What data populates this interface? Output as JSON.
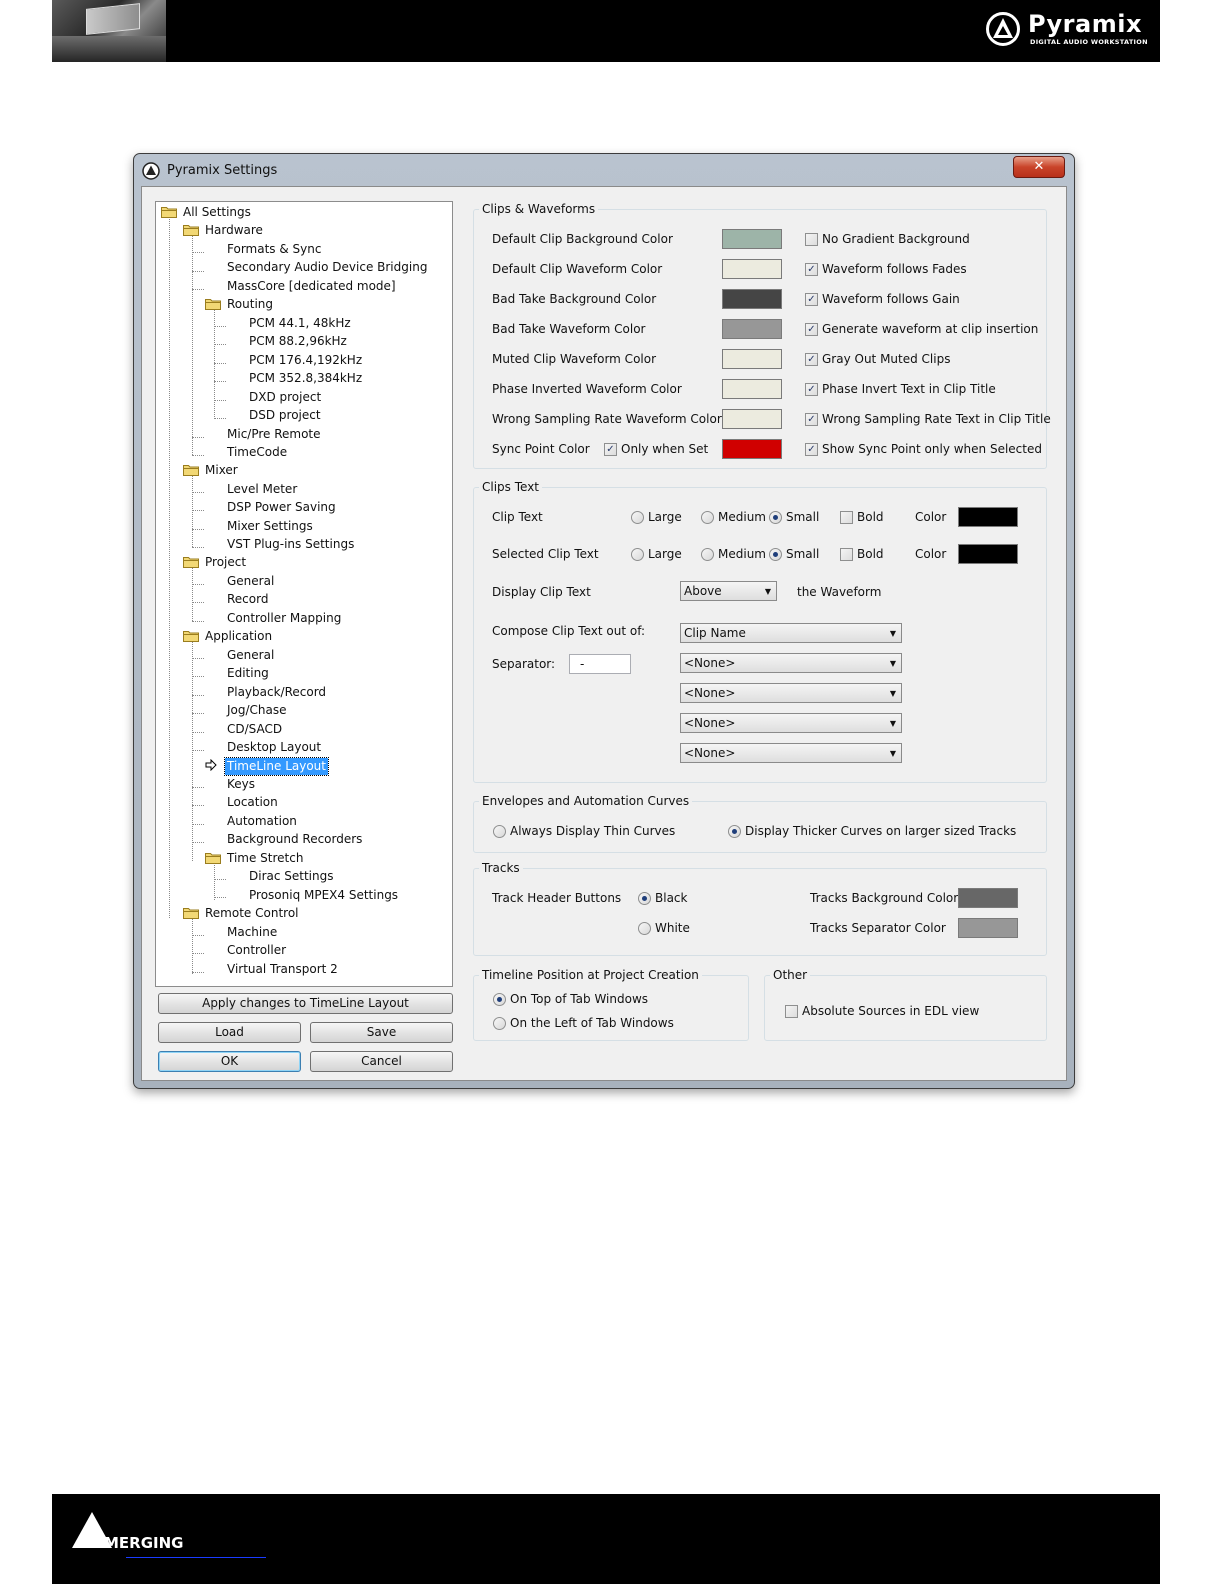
{
  "page_header": {
    "brand": "Pyramix",
    "tagline": "DIGITAL AUDIO WORKSTATION"
  },
  "page_footer": {
    "brand": "MERGING"
  },
  "window": {
    "title": "Pyramix Settings",
    "close_label": "✕"
  },
  "tree": {
    "root": "All Settings",
    "groups": {
      "hardware": "Hardware",
      "routing": "Routing",
      "mixer": "Mixer",
      "project": "Project",
      "application": "Application",
      "time_stretch": "Time Stretch",
      "remote_control": "Remote Control"
    },
    "hardware_items": [
      "Formats & Sync",
      "Secondary Audio Device Bridging",
      "MassCore [dedicated mode]"
    ],
    "routing_items": [
      "PCM 44.1, 48kHz",
      "PCM 88.2,96kHz",
      "PCM 176.4,192kHz",
      "PCM 352.8,384kHz",
      "DXD project",
      "DSD project"
    ],
    "hardware_items2": [
      "Mic/Pre Remote",
      "TimeCode"
    ],
    "mixer_items": [
      "Level Meter",
      "DSP Power Saving",
      "Mixer Settings",
      "VST Plug-ins Settings"
    ],
    "project_items": [
      "General",
      "Record",
      "Controller Mapping"
    ],
    "application_items": [
      "General",
      "Editing",
      "Playback/Record",
      "Jog/Chase",
      "CD/SACD",
      "Desktop Layout",
      "TimeLine Layout",
      "Keys",
      "Location",
      "Automation",
      "Background Recorders"
    ],
    "time_stretch_items": [
      "Dirac Settings",
      "Prosoniq MPEX4 Settings"
    ],
    "remote_items": [
      "Machine",
      "Controller",
      "Virtual Transport 2"
    ],
    "selected": "TimeLine Layout"
  },
  "buttons": {
    "apply": "Apply changes to TimeLine Layout",
    "load": "Load",
    "save": "Save",
    "ok": "OK",
    "cancel": "Cancel"
  },
  "clips_waveforms": {
    "title": "Clips & Waveforms",
    "rows": [
      {
        "label": "Default Clip Background Color",
        "color": "#9db4a8",
        "check_label": "No Gradient Background",
        "checked": false
      },
      {
        "label": "Default Clip Waveform Color",
        "color": "#ecebdf",
        "check_label": "Waveform follows Fades",
        "checked": true
      },
      {
        "label": "Bad Take Background Color",
        "color": "#454545",
        "check_label": "Waveform follows Gain",
        "checked": true
      },
      {
        "label": "Bad Take Waveform Color",
        "color": "#979797",
        "check_label": "Generate waveform at clip insertion",
        "checked": true
      },
      {
        "label": "Muted Clip Waveform Color",
        "color": "#ecebdf",
        "check_label": "Gray Out Muted Clips",
        "checked": true
      },
      {
        "label": "Phase Inverted Waveform Color",
        "color": "#ecebdf",
        "check_label": "Phase Invert Text in Clip Title",
        "checked": true
      },
      {
        "label": "Wrong Sampling Rate Waveform Color",
        "color": "#ecebdf",
        "check_label": "Wrong Sampling Rate Text in Clip Title",
        "checked": true
      },
      {
        "label": "Sync Point Color",
        "color": "#d00000",
        "check_label": "Show Sync Point only when Selected",
        "checked": true
      }
    ],
    "only_when_set_label": "Only when Set",
    "only_when_set_checked": true
  },
  "clips_text": {
    "title": "Clips Text",
    "rows": [
      {
        "label": "Clip Text",
        "size_selected": "Small",
        "bold": false,
        "color": "#000000"
      },
      {
        "label": "Selected Clip Text",
        "size_selected": "Small",
        "bold": false,
        "color": "#000000"
      }
    ],
    "sizes": [
      "Large",
      "Medium",
      "Small"
    ],
    "bold_label": "Bold",
    "color_label": "Color",
    "display_label": "Display Clip Text",
    "display_value": "Above",
    "display_suffix": "the Waveform",
    "compose_label": "Compose Clip Text out of:",
    "compose_values": [
      "Clip Name",
      "<None>",
      "<None>",
      "<None>",
      "<None>"
    ],
    "separator_label": "Separator:",
    "separator_value": "-"
  },
  "envelopes": {
    "title": "Envelopes and Automation Curves",
    "options": [
      "Always Display Thin Curves",
      "Display Thicker Curves on larger sized Tracks"
    ],
    "selected_index": 1
  },
  "tracks": {
    "title": "Tracks",
    "header_buttons_label": "Track Header Buttons",
    "header_options": [
      "Black",
      "White"
    ],
    "header_selected_index": 0,
    "bg_color_label": "Tracks Background Color",
    "bg_color": "#676767",
    "sep_color_label": "Tracks Separator Color",
    "sep_color": "#979797"
  },
  "timeline_position": {
    "title": "Timeline Position at Project Creation",
    "options": [
      "On Top of Tab Windows",
      "On the Left of Tab Windows"
    ],
    "selected_index": 0
  },
  "other": {
    "title": "Other",
    "absolute_sources_label": "Absolute Sources in EDL view",
    "absolute_sources_checked": false
  }
}
